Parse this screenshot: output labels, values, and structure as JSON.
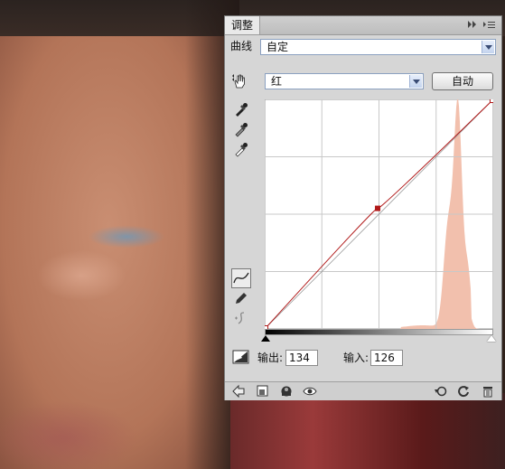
{
  "panel": {
    "tab_label": "调整",
    "adjustment_label": "曲线",
    "preset_value": "自定",
    "channel_value": "红",
    "auto_button_label": "自动",
    "output_label": "输出:",
    "output_value": "134",
    "input_label": "输入:",
    "input_value": "126"
  },
  "icons": {
    "titlebar_menu": "panel-menu-icon",
    "titlebar_collapse": "double-arrow-icon",
    "hand_tool": "hand-adjust-icon",
    "black_point": "black-eyedropper-icon",
    "gray_point": "gray-eyedropper-icon",
    "white_point": "white-eyedropper-icon",
    "curve_tool": "curve-tool-icon",
    "pencil_tool": "pencil-icon",
    "smooth_tool": "smooth-icon",
    "clipping_warning": "clipping-warning-icon",
    "footer_back": "back-arrow-icon",
    "footer_clip": "clip-to-layer-icon",
    "footer_mask": "mask-icon",
    "footer_visibility": "eye-icon",
    "footer_previous": "previous-state-icon",
    "footer_reset": "reset-icon",
    "footer_delete": "trash-icon"
  },
  "colors": {
    "curve": "#b01818",
    "histogram": "#f2c0ad"
  }
}
